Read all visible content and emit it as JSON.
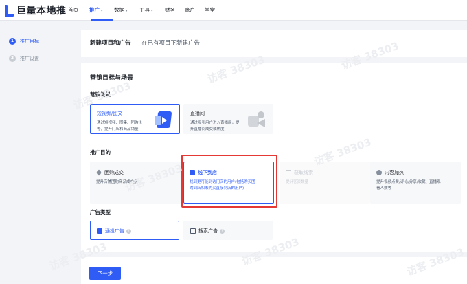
{
  "brand": {
    "logo_text": "巨量本地推"
  },
  "nav": {
    "items": [
      {
        "label": "首页",
        "caret": ""
      },
      {
        "label": "推广",
        "caret": "▾"
      },
      {
        "label": "数据",
        "caret": "▾"
      },
      {
        "label": "工具",
        "caret": "▾"
      },
      {
        "label": "财务",
        "caret": ""
      },
      {
        "label": "账户",
        "caret": ""
      },
      {
        "label": "学堂",
        "caret": ""
      }
    ]
  },
  "sidebar": {
    "steps": [
      {
        "num": "1",
        "label": "推广目标"
      },
      {
        "num": "2",
        "label": "推广设置"
      }
    ]
  },
  "tabs": {
    "new_project": "新建项目和广告",
    "existing_project": "在已有项目下新建广告"
  },
  "main": {
    "section_title": "营销目标与场景",
    "scene_label": "营销场景",
    "scenes": [
      {
        "title": "短视频/图文",
        "desc": [
          "通过短视频、图集、团购卡",
          "等，提升门店和商品销量"
        ]
      },
      {
        "title": "直播间",
        "desc": [
          "通过吸引用户进入直播间，提",
          "升直播间成交或热度"
        ]
      }
    ],
    "purpose_label": "推广目的",
    "purposes": [
      {
        "title": "团购成交",
        "desc": [
          "提升店铺团购商品成交量"
        ]
      },
      {
        "title": "线下到店",
        "desc": [
          "找到更可能到访门店的用户(包括购买团",
          "购到店和未购买直接到店的用户)"
        ]
      },
      {
        "title": "获取线索",
        "desc": [
          "提升客资数量"
        ]
      },
      {
        "title": "内容加热",
        "desc": [
          "提升视频点赞/评论/分享/收藏、直播观",
          "看人数等"
        ]
      }
    ],
    "adtype_label": "广告类型",
    "adtypes": [
      {
        "title": "通投广告",
        "help": "?"
      },
      {
        "title": "搜索广告",
        "help": "?"
      }
    ]
  },
  "footer": {
    "next_label": "下一步"
  },
  "watermarks": [
    "访客 38303",
    "访客 38303",
    "访客 38303",
    "访客 38303",
    "访客 38303",
    "访客 38303",
    "访客 38303",
    "访客 38303"
  ],
  "colors": {
    "accent": "#2f5cf5",
    "highlight": "#e53935"
  }
}
